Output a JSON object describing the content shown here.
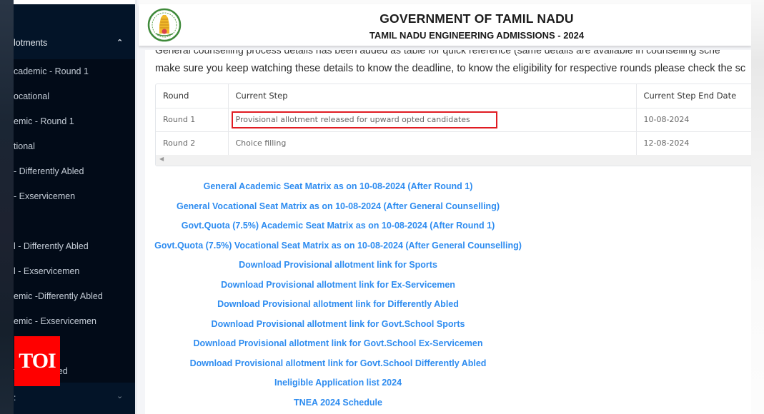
{
  "sidebar": {
    "section_header": {
      "label": "lotments",
      "icon": "chevron-up-icon"
    },
    "items": [
      {
        "label": "cademic - Round 1"
      },
      {
        "label": "ocational"
      },
      {
        "label": "emic - Round 1"
      },
      {
        "label": "tional"
      },
      {
        "label": " - Differently Abled"
      },
      {
        "label": " - Exservicemen"
      },
      {
        "label": ""
      },
      {
        "label": "l - Differently Abled"
      },
      {
        "label": "l - Exservicemen"
      },
      {
        "label": "emic -Differently Abled"
      },
      {
        "label": "emic - Exservicemen"
      },
      {
        "label": ":"
      },
      {
        "label": "ferently Abled"
      }
    ],
    "footer": {
      "label": ":",
      "icon": "chevron-down-icon"
    }
  },
  "watermark": {
    "label": "TOI",
    "color": "#ff0000"
  },
  "header": {
    "title": "GOVERNMENT OF TAMIL NADU",
    "subtitle": "TAMIL NADU ENGINEERING ADMISSIONS - 2024",
    "logo": "tamil-nadu-emblem"
  },
  "notice": {
    "line1": "General counselling process details has been added as table for quick reference (same details are available in counselling sche",
    "line2": "make sure you keep watching these details to know the deadline, to know the eligibility for respective rounds please check the sc"
  },
  "table": {
    "headers": [
      "Round",
      "Current Step",
      "Current Step End Date"
    ],
    "rows": [
      {
        "round": "Round 1",
        "step": "Provisional allotment released for upward opted candidates",
        "end_date": "10-08-2024",
        "highlighted": true
      },
      {
        "round": "Round 2",
        "step": "Choice filling",
        "end_date": "12-08-2024",
        "highlighted": false
      }
    ],
    "highlight_color": "#e01b22"
  },
  "links": [
    "General Academic Seat Matrix as on 10-08-2024 (After Round 1)",
    "General Vocational Seat Matrix as on 10-08-2024 (After General Counselling)",
    "Govt.Quota (7.5%) Academic Seat Matrix as on 10-08-2024 (After Round 1)",
    "Govt.Quota (7.5%) Vocational Seat Matrix as on 10-08-2024 (After General Counselling)",
    "Download Provisional allotment link for Sports",
    "Download Provisional allotment link for Ex-Servicemen",
    "Download Provisional allotment link for Differently Abled",
    "Download Provisional allotment link for Govt.School Sports",
    "Download Provisional allotment link for Govt.School Ex-Servicemen",
    "Download Provisional allotment link for Govt.School Differently Abled",
    "Ineligible Application list 2024",
    "TNEA 2024 Schedule"
  ],
  "colors": {
    "link": "#2e8cf0",
    "sidebar_bg": "#020b18",
    "sidebar_header_bg": "#031428"
  }
}
